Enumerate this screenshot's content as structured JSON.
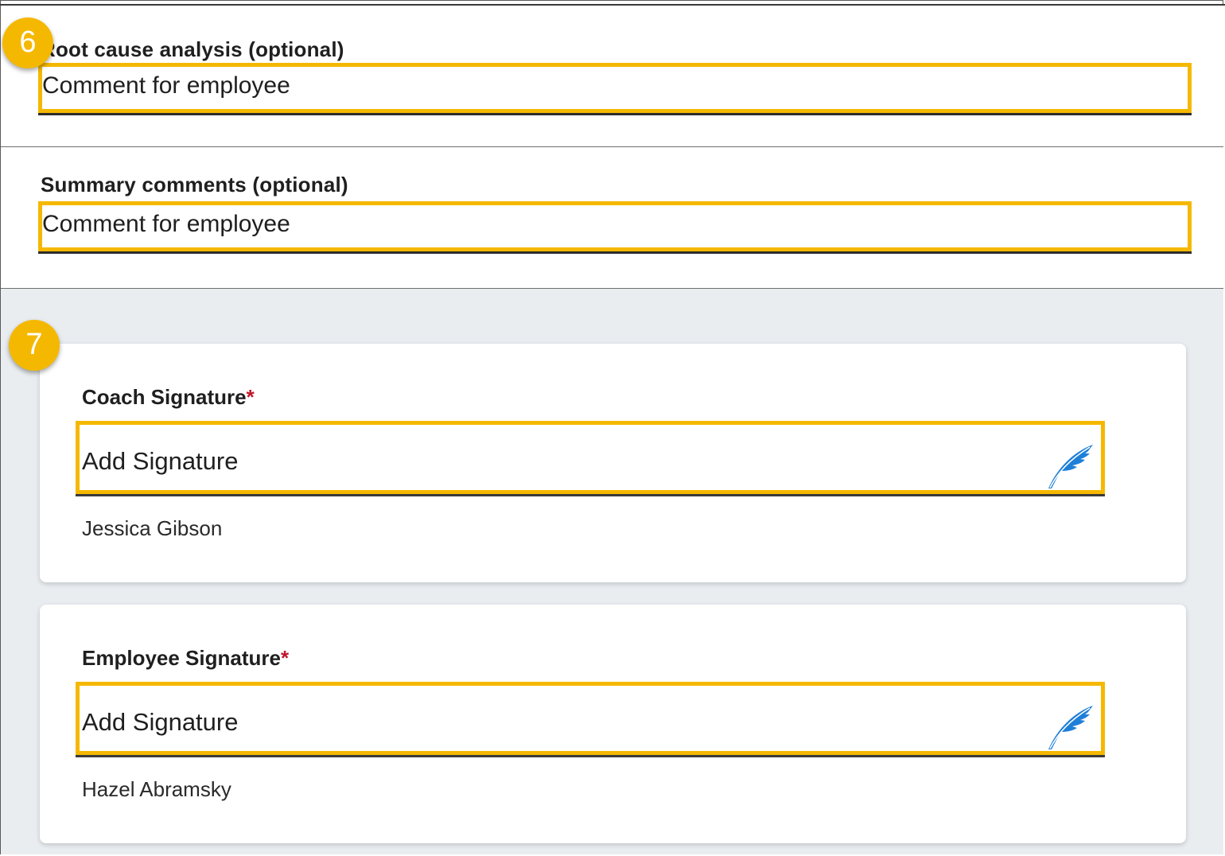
{
  "root_cause": {
    "label": "Root cause analysis (optional)",
    "value": "Comment for employee"
  },
  "summary": {
    "label": "Summary comments (optional)",
    "value": "Comment for employee"
  },
  "coach_signature": {
    "label": "Coach Signature",
    "required_marker": "*",
    "placeholder": "Add Signature",
    "signer": "Jessica Gibson",
    "icon": "quill-icon"
  },
  "employee_signature": {
    "label": "Employee Signature",
    "required_marker": "*",
    "placeholder": "Add Signature",
    "signer": "Hazel Abramsky",
    "icon": "quill-icon"
  },
  "callouts": {
    "step_6": "6",
    "step_7": "7"
  },
  "colors": {
    "highlight": "#f5b800",
    "required": "#c0152a",
    "quill": "#1e7fd8",
    "signature_area_bg": "#e9edf0"
  }
}
